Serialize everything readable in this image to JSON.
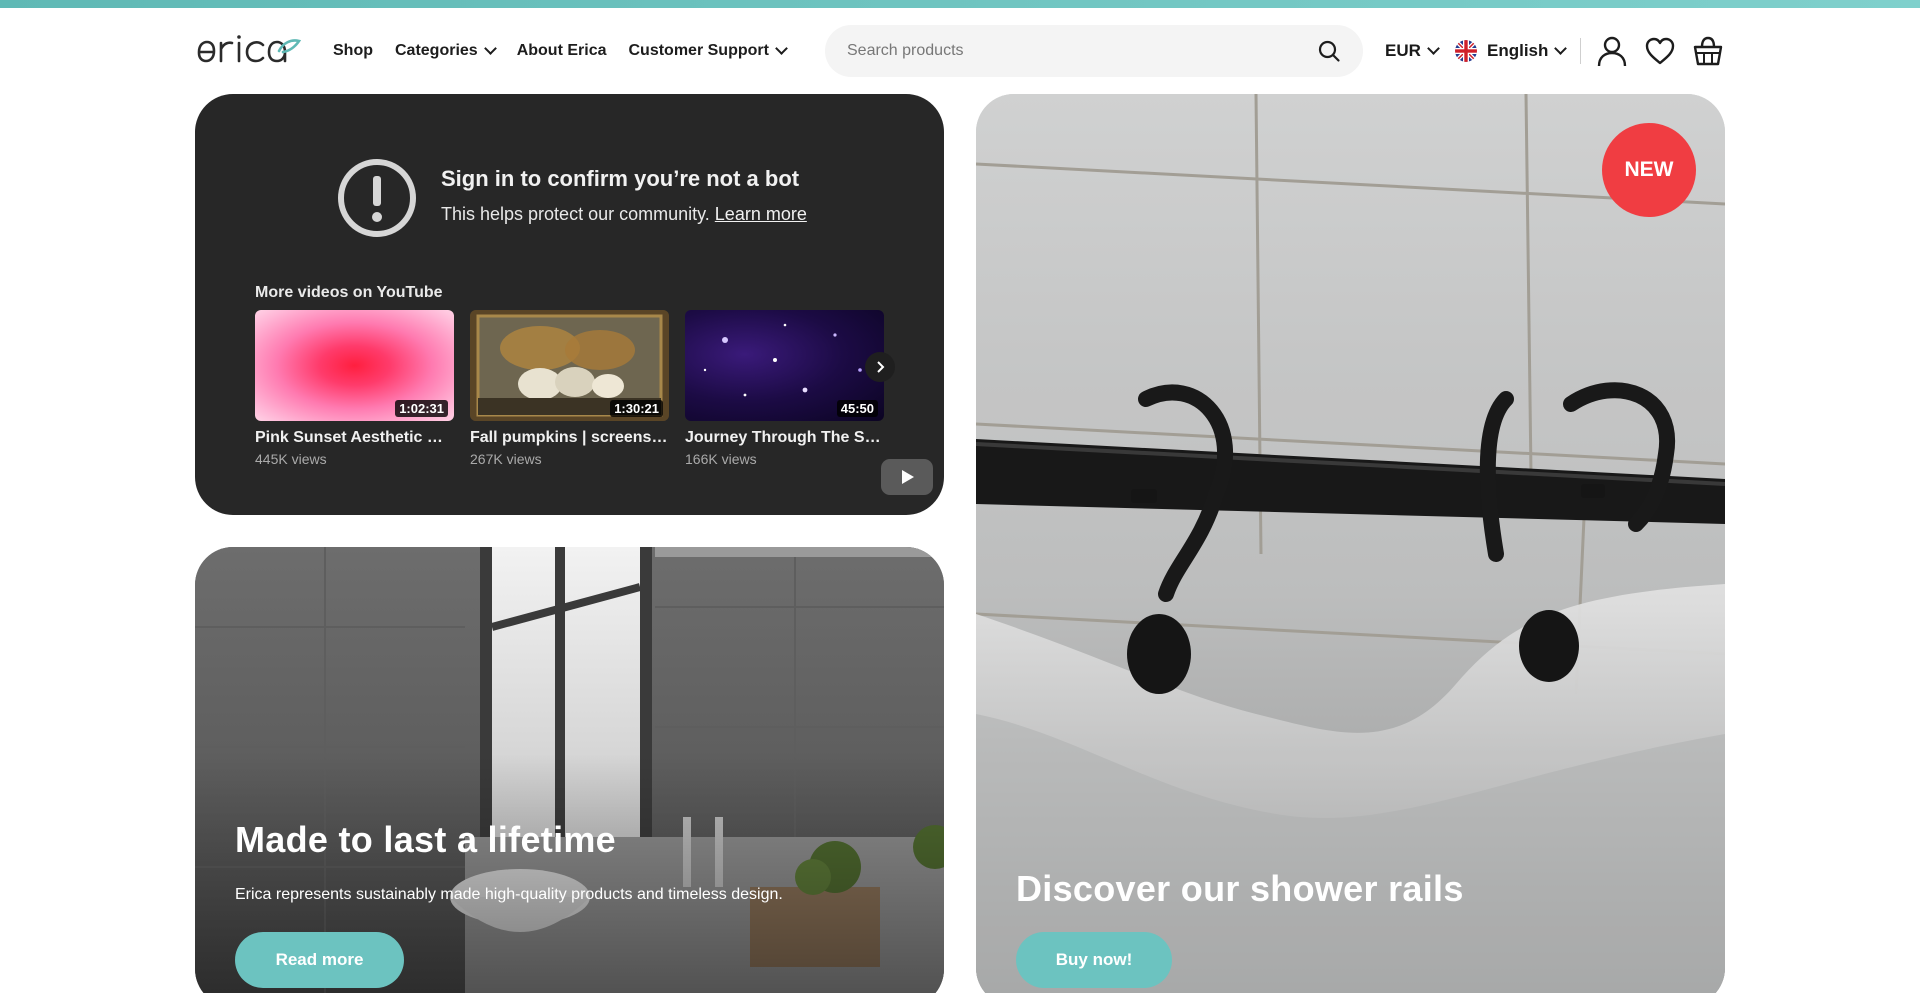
{
  "header": {
    "logo_text": "erica",
    "nav": {
      "shop": "Shop",
      "categories": "Categories",
      "about": "About Erica",
      "support": "Customer Support"
    },
    "search_placeholder": "Search products",
    "currency": "EUR",
    "language": "English",
    "icons": [
      "search-icon",
      "chevron-down-icon",
      "uk-flag-icon",
      "user-icon",
      "heart-icon",
      "basket-icon"
    ]
  },
  "youtube_embed": {
    "title": "Sign in to confirm you’re not a bot",
    "subtitle": "This helps protect our community.",
    "learn_more": "Learn more",
    "more_videos_label": "More videos on YouTube",
    "videos": [
      {
        "title": "Pink Sunset Aesthetic Gra...",
        "views": "445K views",
        "duration": "1:02:31"
      },
      {
        "title": "Fall pumpkins | screensav...",
        "views": "267K views",
        "duration": "1:30:21"
      },
      {
        "title": "Journey Through The Stars",
        "views": "166K views",
        "duration": "45:50"
      }
    ]
  },
  "lifetime_card": {
    "title": "Made to last a lifetime",
    "text": "Erica represents sustainably made high-quality products and timeless design.",
    "button": "Read more"
  },
  "shower_card": {
    "badge": "NEW",
    "title": "Discover our shower rails",
    "button": "Buy now!"
  },
  "colors": {
    "accent": "#6cc3c0",
    "badge": "#f03d42",
    "embed_bg": "#272727"
  }
}
